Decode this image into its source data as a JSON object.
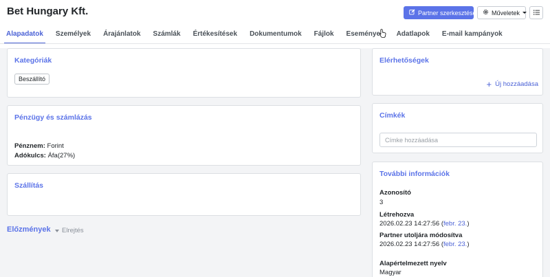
{
  "header": {
    "title": "Bet Hungary Kft.",
    "edit_button": "Partner szerkesztése",
    "actions_button": "Műveletek"
  },
  "tabs": [
    {
      "label": "Alapadatok",
      "active": true
    },
    {
      "label": "Személyek"
    },
    {
      "label": "Árajánlatok"
    },
    {
      "label": "Számlák"
    },
    {
      "label": "Értékesítések"
    },
    {
      "label": "Dokumentumok"
    },
    {
      "label": "Fájlok"
    },
    {
      "label": "Események"
    },
    {
      "label": "Adatlapok"
    },
    {
      "label": "E-mail kampányok"
    }
  ],
  "categories": {
    "title": "Kategóriák",
    "badge": "Beszállító"
  },
  "finance": {
    "title": "Pénzügy és számlázás",
    "currency_label": "Pénznem:",
    "currency_value": "Forint",
    "tax_label": "Adókulcs:",
    "tax_value": "Áfa(27%)"
  },
  "shipping": {
    "title": "Szállítás"
  },
  "history": {
    "title": "Előzmények",
    "toggle": "Elrejtés"
  },
  "contacts": {
    "title": "Elérhetőségek",
    "add_label": "Új hozzáadása"
  },
  "tags": {
    "title": "Címkék",
    "placeholder": "Címke hozzáadása"
  },
  "more_info": {
    "title": "További információk",
    "id_label": "Azonosító",
    "id_value": "3",
    "created_label": "Létrehozva",
    "created_value": "2026.02.23 14:27:56",
    "created_rel_open": "(",
    "created_rel": "febr. 23.",
    "created_rel_close": ")",
    "modified_label": "Partner utoljára módosítva",
    "modified_value": "2026.02.23 14:27:56",
    "modified_rel_open": "(",
    "modified_rel": "febr. 23.",
    "modified_rel_close": ")",
    "language_label": "Alapértelmezett nyelv",
    "language_value": "Magyar"
  },
  "colors": {
    "accent": "#5b73e8",
    "link": "#4b62d6",
    "background": "#f3f4f6"
  },
  "icons": {
    "edit": "pencil-square-icon",
    "actions": "gear-icon",
    "list": "list-icon",
    "add": "plus-icon"
  }
}
